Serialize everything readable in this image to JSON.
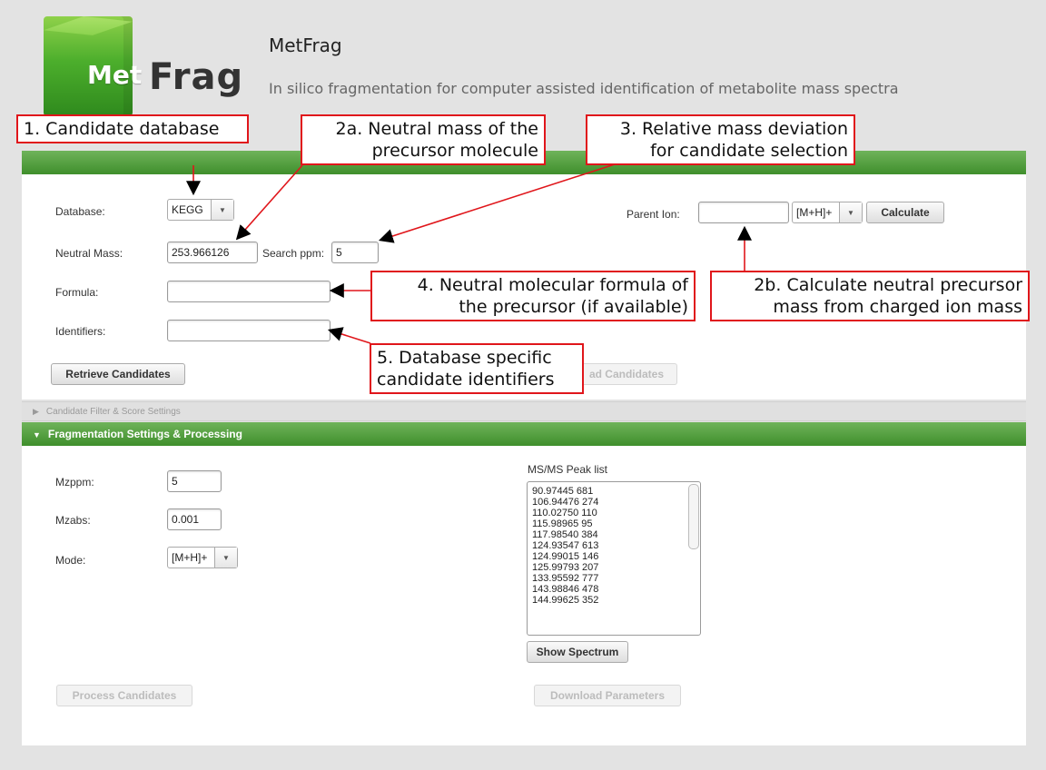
{
  "header": {
    "logo_met": "Met",
    "logo_frag": "Frag",
    "title": "MetFrag",
    "subtitle": "In silico fragmentation for computer assisted identification of metabolite mass spectra"
  },
  "database_section": {
    "database_label": "Database:",
    "database_value": "KEGG",
    "neutral_mass_label": "Neutral Mass:",
    "neutral_mass_value": "253.966126",
    "search_ppm_label": "Search ppm:",
    "search_ppm_value": "5",
    "formula_label": "Formula:",
    "formula_value": "",
    "identifiers_label": "Identifiers:",
    "identifiers_value": "",
    "retrieve_button": "Retrieve Candidates",
    "download_candidates_button": "ad Candidates",
    "parent_ion_label": "Parent Ion:",
    "parent_ion_value": "",
    "parent_ion_mode": "[M+H]+",
    "calculate_button": "Calculate"
  },
  "candidate_filter": {
    "header": "Candidate Filter & Score Settings"
  },
  "fragmentation": {
    "header": "Fragmentation Settings & Processing",
    "mzppm_label": "Mzppm:",
    "mzppm_value": "5",
    "mzabs_label": "Mzabs:",
    "mzabs_value": "0.001",
    "mode_label": "Mode:",
    "mode_value": "[M+H]+",
    "peaklist_label": "MS/MS Peak list",
    "peaks": [
      "90.97445 681",
      "106.94476 274",
      "110.02750 110",
      "115.98965 95",
      "117.98540 384",
      "124.93547 613",
      "124.99015 146",
      "125.99793 207",
      "133.95592 777",
      "143.98846 478",
      "144.99625 352"
    ],
    "show_spectrum_button": "Show Spectrum",
    "process_button": "Process Candidates",
    "download_params_button": "Download Parameters"
  },
  "annotations": {
    "a1": [
      "1. Candidate database"
    ],
    "a2a": [
      "2a. Neutral mass of the",
      "precursor molecule"
    ],
    "a3": [
      "3. Relative mass deviation",
      "for candidate selection"
    ],
    "a4": [
      "4. Neutral molecular formula of",
      "the precursor (if available)"
    ],
    "a2b": [
      "2b. Calculate neutral precursor",
      "mass from charged ion mass"
    ],
    "a5": [
      "5. Database specific",
      "candidate identifiers"
    ]
  }
}
